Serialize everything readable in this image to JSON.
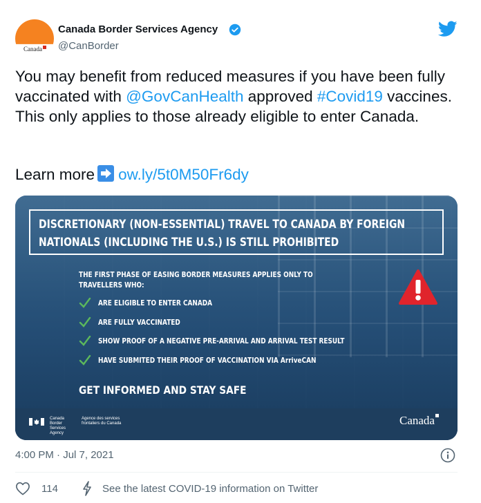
{
  "account": {
    "name": "Canada Border Services Agency",
    "handle": "@CanBorder",
    "avatar_wordmark": "Canada",
    "verified": true
  },
  "tweet": {
    "text_part1": "You may benefit from reduced measures if you have been fully vaccinated with ",
    "mention": "@GovCanHealth",
    "text_part2": " approved ",
    "hashtag": "#Covid19",
    "text_part3": " vaccines. This only applies to those already eligible to enter Canada.",
    "learn_more_label": "Learn more",
    "learn_more_link": "ow.ly/5t0M50Fr6dy",
    "timestamp": "4:00 PM · Jul 7, 2021"
  },
  "image": {
    "headline": "DISCRETIONARY (NON-ESSENTIAL) TRAVEL TO CANADA BY FOREIGN NATIONALS (INCLUDING THE U.S.) IS STILL PROHIBITED",
    "intro": "THE FIRST PHASE OF EASING BORDER MEASURES APPLIES ONLY TO TRAVELLERS WHO:",
    "items": [
      "ARE ELIGIBLE TO ENTER CANADA",
      "ARE FULLY VACCINATED",
      "SHOW PROOF OF A NEGATIVE PRE-ARRIVAL AND ARRIVAL TEST RESULT",
      "HAVE SUBMITED THEIR PROOF OF VACCINATION VIA ArriveCAN"
    ],
    "closing": "GET INFORMED AND STAY SAFE",
    "agency_en": "Canada Border Services Agency",
    "agency_fr": "Agence des services frontaliers du Canada",
    "wordmark": "Canada"
  },
  "actions": {
    "like_count": "114",
    "covid_info": "See the latest COVID-19 information on Twitter"
  },
  "colors": {
    "link": "#1d9bf0",
    "verified": "#1d9bf0",
    "avatar_orange": "#f58220",
    "check_green": "#5cb85c",
    "warning_red": "#e0242c"
  },
  "icons": [
    "verified-badge-icon",
    "twitter-bird-icon",
    "arrow-right-icon",
    "check-icon",
    "warning-icon",
    "info-icon",
    "heart-icon",
    "bolt-icon"
  ]
}
